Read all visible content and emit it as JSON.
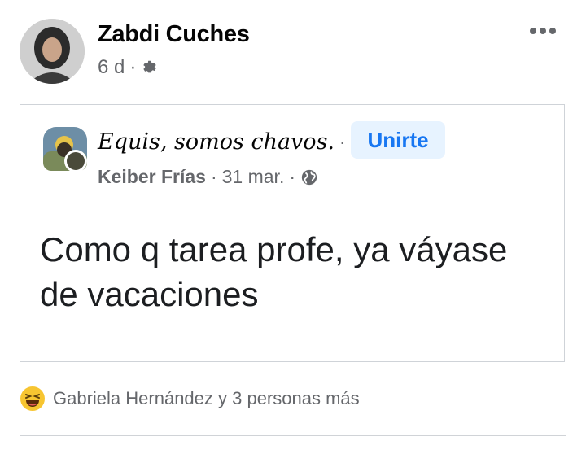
{
  "post": {
    "author": "Zabdi Cuches",
    "time": "6 d",
    "separator": "·",
    "privacy_icon": "gear-icon",
    "more_icon": "more-options-icon"
  },
  "shared": {
    "group_name": "Equis, somos chavos.",
    "separator": "·",
    "join_label": "Unirte",
    "author": "Keiber Frías",
    "date": "31 mar.",
    "privacy_icon": "globe-icon",
    "text": "Como q tarea profe, ya váyase de vacaciones"
  },
  "reactions": {
    "emoji": "laughing-emoji-icon",
    "text": "Gabriela Hernández y 3 personas más"
  },
  "colors": {
    "accent": "#1877f2",
    "accent_bg": "#e7f3ff",
    "secondary_text": "#65676b",
    "border": "#cfd3d8"
  }
}
